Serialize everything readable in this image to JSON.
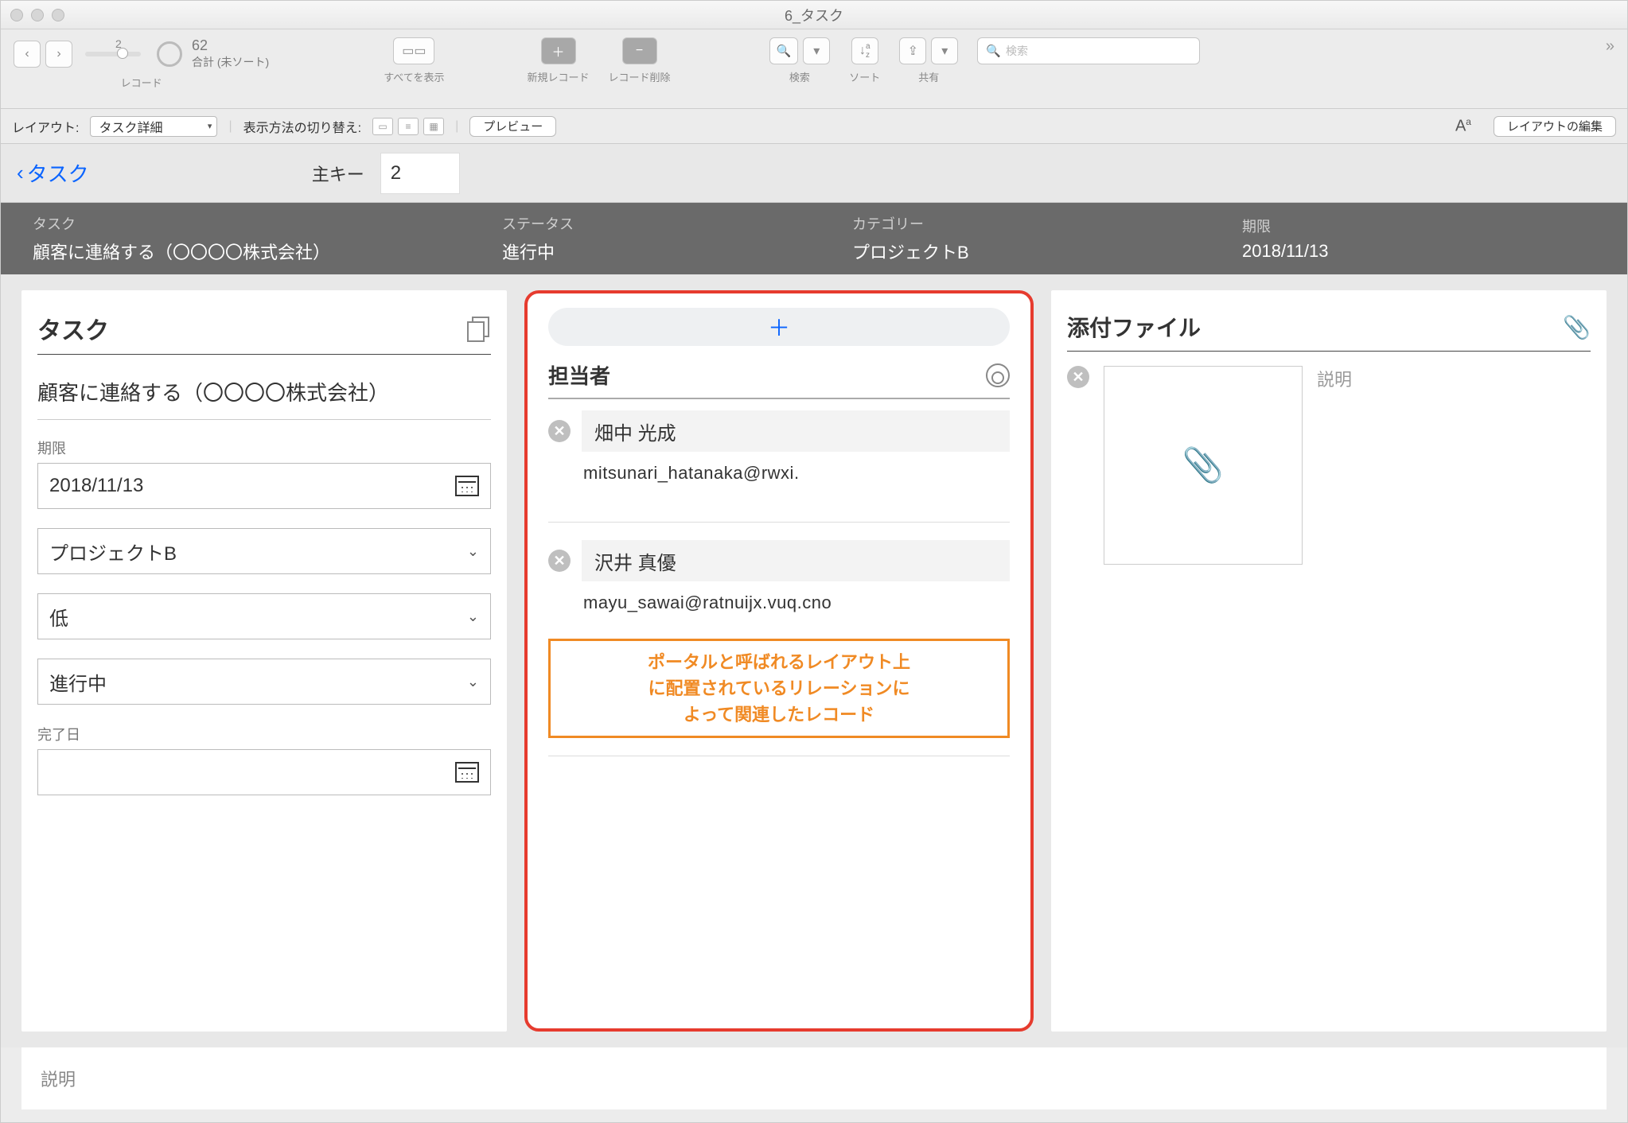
{
  "window": {
    "title": "6_タスク"
  },
  "toolbar": {
    "records_label": "レコード",
    "slider_value": "2",
    "total": "62",
    "total_label": "合計 (未ソート)",
    "show_all": "すべてを表示",
    "new_record": "新規レコード",
    "delete_record": "レコード削除",
    "search": "検索",
    "sort": "ソート",
    "share": "共有",
    "search_placeholder": "検索"
  },
  "layoutbar": {
    "layout_label": "レイアウト:",
    "layout_value": "タスク詳細",
    "view_toggle_label": "表示方法の切り替え:",
    "preview": "プレビュー",
    "edit_layout": "レイアウトの編集"
  },
  "subheader": {
    "back": "タスク",
    "key_label": "主キー",
    "key_value": "2"
  },
  "darkbar": {
    "c1_lbl": "タスク",
    "c1_val": "顧客に連絡する（〇〇〇〇株式会社）",
    "c2_lbl": "ステータス",
    "c2_val": "進行中",
    "c3_lbl": "カテゴリー",
    "c3_val": "プロジェクトB",
    "c4_lbl": "期限",
    "c4_val": "2018/11/13"
  },
  "task_panel": {
    "heading": "タスク",
    "task_name": "顧客に連絡する（〇〇〇〇株式会社）",
    "due_label": "期限",
    "due_value": "2018/11/13",
    "category": "プロジェクトB",
    "priority": "低",
    "status": "進行中",
    "done_label": "完了日",
    "done_value": ""
  },
  "assignee_panel": {
    "heading": "担当者",
    "rows": [
      {
        "name": "畑中 光成",
        "email": "mitsunari_hatanaka@rwxi."
      },
      {
        "name": "沢井 真優",
        "email": "mayu_sawai@ratnuijx.vuq.cno"
      }
    ],
    "note_l1": "ポータルと呼ばれるレイアウト上",
    "note_l2": "に配置されているリレーションに",
    "note_l3": "よって関連したレコード"
  },
  "attach_panel": {
    "heading": "添付ファイル",
    "desc_label": "説明"
  },
  "footer": {
    "desc_label": "説明"
  }
}
